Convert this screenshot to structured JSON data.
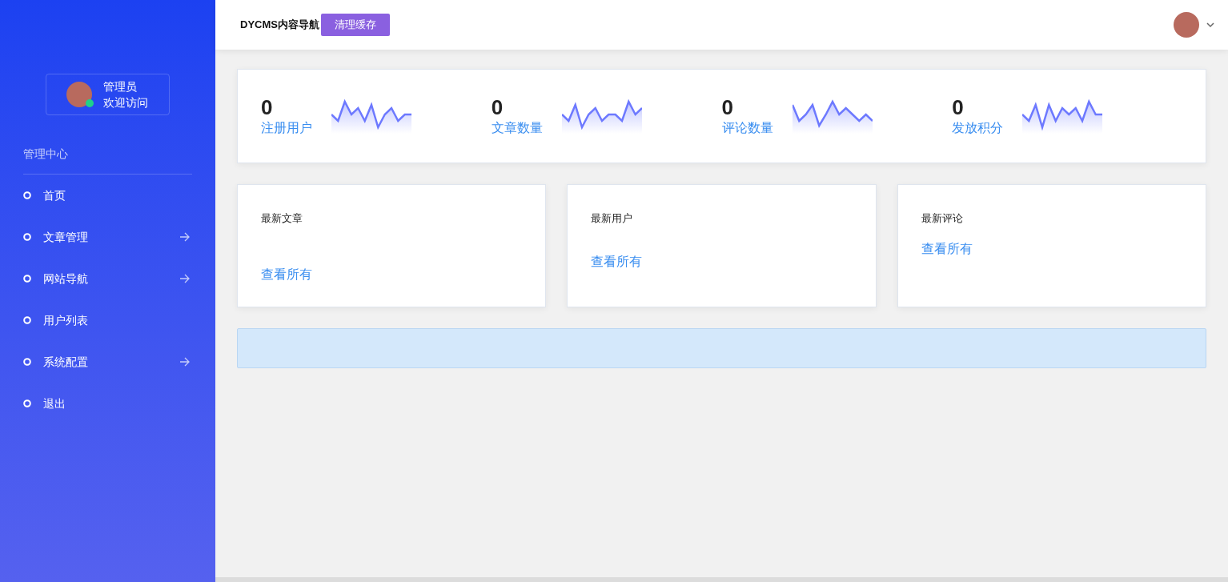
{
  "sidebar": {
    "user": {
      "name": "管理员",
      "greeting": "欢迎访问",
      "online": true
    },
    "section_title": "管理中心",
    "items": [
      {
        "label": "首页",
        "has_submenu": false
      },
      {
        "label": "文章管理",
        "has_submenu": true
      },
      {
        "label": "网站导航",
        "has_submenu": true
      },
      {
        "label": "用户列表",
        "has_submenu": false
      },
      {
        "label": "系统配置",
        "has_submenu": true
      },
      {
        "label": "退出",
        "has_submenu": false
      }
    ]
  },
  "header": {
    "title": "DYCMS内容导航",
    "button": "清理缓存"
  },
  "stats": [
    {
      "value": "0",
      "label": "注册用户"
    },
    {
      "value": "0",
      "label": "文章数量"
    },
    {
      "value": "0",
      "label": "评论数量"
    },
    {
      "value": "0",
      "label": "发放积分"
    }
  ],
  "cards": [
    {
      "title": "最新文章",
      "link": "查看所有"
    },
    {
      "title": "最新用户",
      "link": "查看所有"
    },
    {
      "title": "最新评论",
      "link": "查看所有"
    }
  ]
}
